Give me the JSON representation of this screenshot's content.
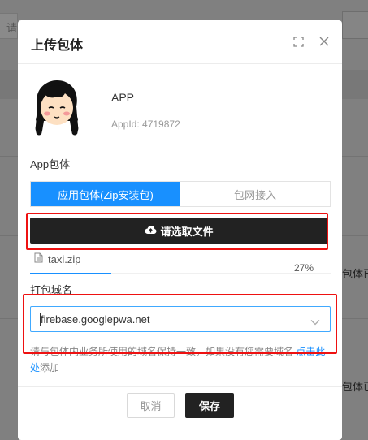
{
  "background": {
    "search_placeholder": "请",
    "row_text_1": "包体已",
    "row_text_2": "包体已"
  },
  "modal": {
    "title": "上传包体",
    "app": {
      "name": "APP",
      "app_id": "AppId: 4719872",
      "avatar_icon": "girl-avatar-icon"
    },
    "package_label": "App包体",
    "tabs": [
      {
        "label": "应用包体(Zip安装包)",
        "active": true
      },
      {
        "label": "包网接入",
        "active": false
      }
    ],
    "select_file_label": "请选取文件",
    "upload": {
      "file_name": "taxi.zip",
      "progress_text": "27%",
      "progress": 0.27
    },
    "domain_label": "打包域名",
    "domain": {
      "value": "firebase.googlepwa.net"
    },
    "hint": {
      "text": "请与包体内业务所使用的域名保持一致，如果没有您需要域名 ",
      "link": "点击此处",
      "suffix": "添加"
    },
    "cancel_label": "取消",
    "save_label": "保存"
  },
  "colors": {
    "primary": "#1890ff",
    "dark_button": "#222222",
    "highlight_box": "#ee1111"
  }
}
